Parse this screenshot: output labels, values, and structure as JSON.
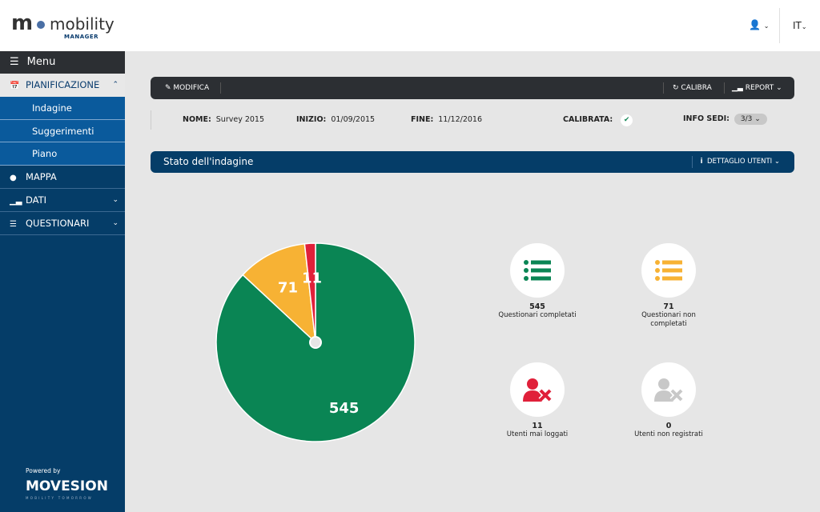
{
  "header": {
    "logo_text": "mobility",
    "logo_sub": "MANAGER",
    "user_icon": "user-icon",
    "language": "IT"
  },
  "sidebar": {
    "menu_label": "Menu",
    "items": [
      {
        "label": "PIANIFICAZIONE",
        "icon": "calendar-icon",
        "expanded": true,
        "children": [
          "Indagine",
          "Suggerimenti",
          "Piano"
        ]
      },
      {
        "label": "MAPPA",
        "icon": "map-marker-icon"
      },
      {
        "label": "DATI",
        "icon": "bar-chart-icon"
      },
      {
        "label": "QUESTIONARI",
        "icon": "list-icon"
      }
    ],
    "powered_by": "Powered by",
    "brand": "MOVESION",
    "brand_tagline": "MOBILITY TOMORROW"
  },
  "toolbar": {
    "edit": "MODIFICA",
    "calibrate": "CALIBRA",
    "report": "REPORT"
  },
  "survey": {
    "name_label": "NOME:",
    "name": "Survey 2015",
    "start_label": "INIZIO:",
    "start": "01/09/2015",
    "end_label": "FINE:",
    "end": "11/12/2016",
    "calibrated_label": "CALIBRATA:",
    "calibrated": true,
    "sites_label": "INFO SEDI:",
    "sites": "3/3"
  },
  "status": {
    "title": "Stato dell'indagine",
    "detail": "DETTAGLIO UTENTI"
  },
  "colors": {
    "green": "#0a8554",
    "yellow": "#f7b234",
    "red": "#e0203a",
    "grey": "#c8c8c8"
  },
  "chart_data": {
    "type": "pie",
    "slices": [
      {
        "value": 545,
        "label": "545",
        "color": "#0a8554"
      },
      {
        "value": 71,
        "label": "71",
        "color": "#f7b234"
      },
      {
        "value": 11,
        "label": "11",
        "color": "#e0203a"
      }
    ]
  },
  "cards": [
    {
      "value": "545",
      "label": "Questionari completati",
      "icon": "list-icon",
      "color": "#0a8554"
    },
    {
      "value": "71",
      "label": "Questionari non completati",
      "icon": "list-icon",
      "color": "#f7b234"
    },
    {
      "value": "11",
      "label": "Utenti mai loggati",
      "icon": "user-times-icon",
      "color": "#e0203a"
    },
    {
      "value": "0",
      "label": "Utenti non registrati",
      "icon": "user-times-icon",
      "color": "#c8c8c8"
    }
  ]
}
